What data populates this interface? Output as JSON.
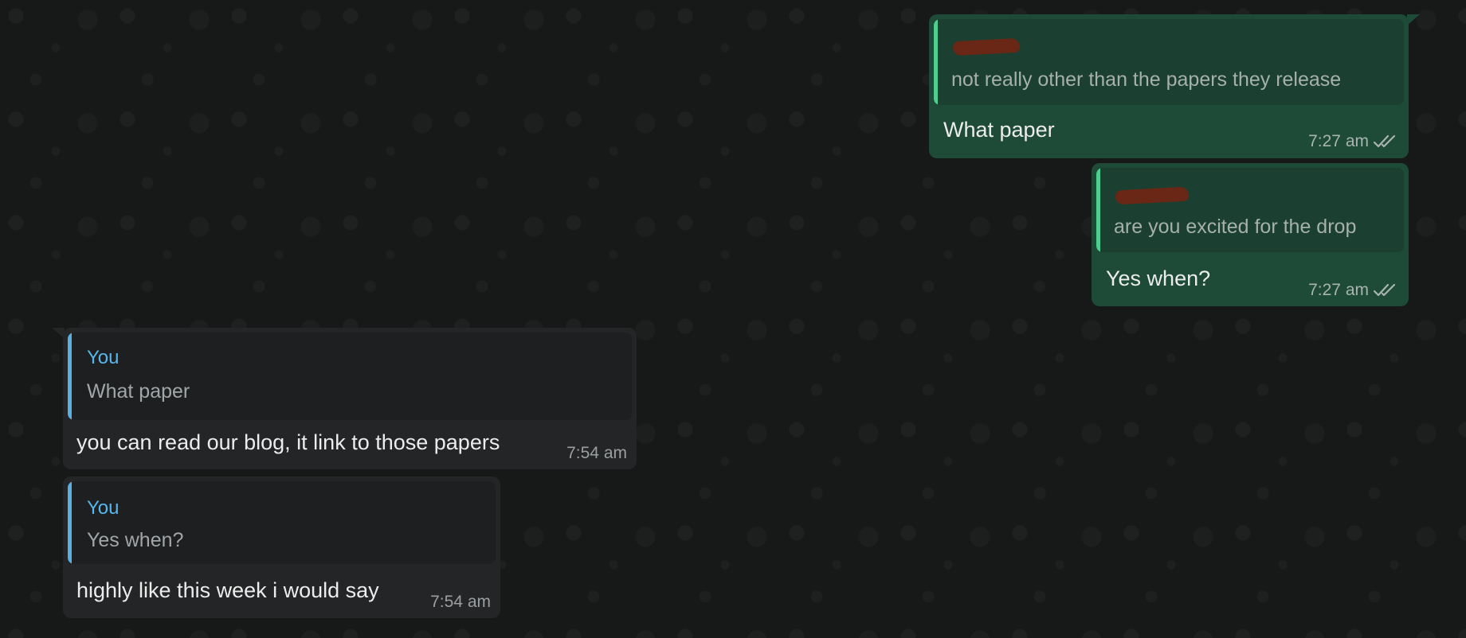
{
  "chat": {
    "messages": [
      {
        "direction": "outgoing",
        "quote": {
          "author": "",
          "text": "not really other than the papers they release"
        },
        "text": "What paper",
        "time": "7:27 am",
        "status": "read"
      },
      {
        "direction": "outgoing",
        "quote": {
          "author": "",
          "text": "are you excited for the drop"
        },
        "text": "Yes when?",
        "time": "7:27 am",
        "status": "read"
      },
      {
        "direction": "incoming",
        "quote": {
          "author": "You",
          "text": "What paper"
        },
        "text": "you can read our blog, it link to those papers",
        "time": "7:54 am"
      },
      {
        "direction": "incoming",
        "quote": {
          "author": "You",
          "text": "Yes when?"
        },
        "text": "highly like this week i would say",
        "time": "7:54 am"
      }
    ]
  },
  "icons": {
    "read_status": "double-check-icon"
  },
  "colors": {
    "outgoing_bubble": "#1e4a38",
    "incoming_bubble": "#232526",
    "outgoing_quote_bar": "#4fce8f",
    "incoming_quote_bar": "#5aaee0",
    "incoming_author": "#59b6ec",
    "redaction": "#6b2716"
  }
}
